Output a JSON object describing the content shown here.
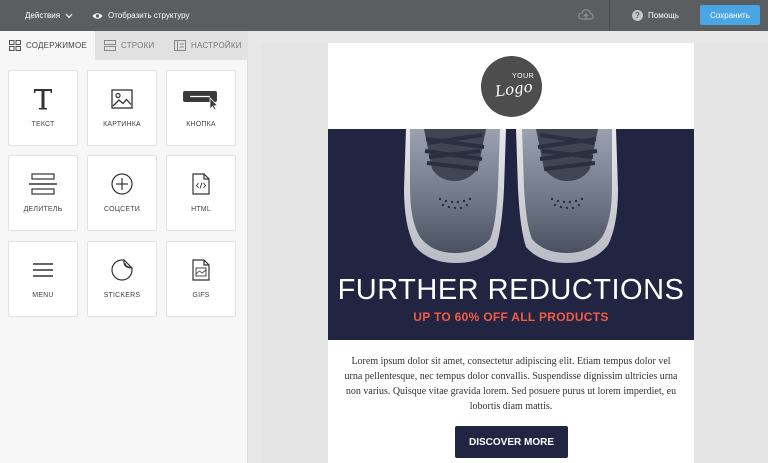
{
  "topbar": {
    "actions_label": "Действия",
    "structure_label": "Отобразить структуру",
    "help_label": "Помощь",
    "save_label": "Сохранить"
  },
  "tabs": [
    {
      "label": "СОДЕРЖИМОЕ",
      "active": true
    },
    {
      "label": "СТРОКИ",
      "active": false
    },
    {
      "label": "НАСТРОЙКИ",
      "active": false
    }
  ],
  "tiles": [
    {
      "label": "ТЕКСТ",
      "icon": "text-icon"
    },
    {
      "label": "КАРТИНКА",
      "icon": "image-icon"
    },
    {
      "label": "КНОПКА",
      "icon": "button-icon"
    },
    {
      "label": "ДЕЛИТЕЛЬ",
      "icon": "divider-icon"
    },
    {
      "label": "СОЦСЕТИ",
      "icon": "plus-circle-icon"
    },
    {
      "label": "HTML",
      "icon": "html-file-icon"
    },
    {
      "label": "MENU",
      "icon": "menu-icon"
    },
    {
      "label": "STICKERS",
      "icon": "sticker-icon"
    },
    {
      "label": "GIFS",
      "icon": "gif-file-icon"
    }
  ],
  "email": {
    "logo_small": "YOUR",
    "logo_word": "Logo",
    "hero_title": "FURTHER REDUCTIONS",
    "hero_subtitle": "UP TO 60% OFF ALL PRODUCTS",
    "body": "Lorem ipsum dolor sit amet, consectetur adipiscing elit. Etiam tempus dolor vel urna pellentesque, nec tempus dolor convallis. Suspendisse dignissim ultricies urna non varius. Quisque vitae gravida lorem. Sed posuere purus ut lorem imperdiet, eu lobortis diam mattis.",
    "cta_label": "DISCOVER MORE"
  },
  "colors": {
    "topbar": "#5b5e61",
    "save_button": "#4aa5e5",
    "hero_bg": "#212541",
    "accent_red": "#f25b45"
  }
}
